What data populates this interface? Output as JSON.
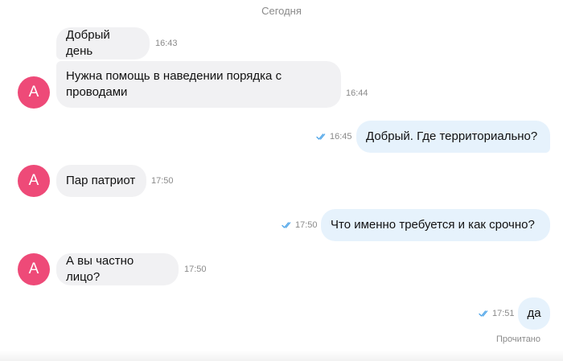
{
  "chat": {
    "date_separator": "Сегодня",
    "read_status": "Прочитано",
    "colors": {
      "avatar": "#ee4a78",
      "incoming_bubble": "#f1f1f3",
      "outgoing_bubble": "#e6f2fc",
      "read_checks": "#4aa3e8"
    },
    "messages": [
      {
        "direction": "incoming",
        "text": "Добрый день",
        "time": "16:43"
      },
      {
        "direction": "incoming",
        "text": "Нужна помощь в наведении порядка с проводами",
        "time": "16:44",
        "avatar": "А"
      },
      {
        "direction": "outgoing",
        "text": "Добрый. Где территориально?",
        "time": "16:45",
        "checks": "double-check-icon"
      },
      {
        "direction": "incoming",
        "text": "Пар патриот",
        "time": "17:50",
        "avatar": "А"
      },
      {
        "direction": "outgoing",
        "text": "Что именно требуется и как срочно?",
        "time": "17:50",
        "checks": "double-check-icon"
      },
      {
        "direction": "incoming",
        "text": "А вы частно лицо?",
        "time": "17:50",
        "avatar": "А"
      },
      {
        "direction": "outgoing",
        "text": "да",
        "time": "17:51",
        "checks": "double-check-icon"
      }
    ]
  }
}
